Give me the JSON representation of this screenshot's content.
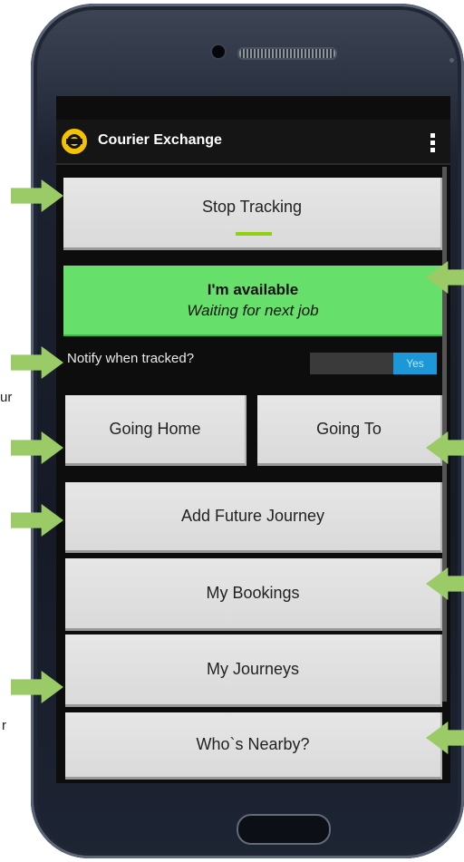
{
  "app": {
    "title": "Courier Exchange",
    "logo_icon": "courier-exchange-logo-icon",
    "menu_icon": "overflow-menu-icon"
  },
  "tracking": {
    "button_label": "Stop Tracking",
    "indicator_color": "#8fd10f"
  },
  "status": {
    "line1": "I'm available",
    "line2": "Waiting for next job",
    "color": "#66e06b"
  },
  "notify": {
    "label": "Notify when tracked?",
    "toggle_value": "Yes",
    "toggle_color": "#1c98d9"
  },
  "buttons": {
    "going_home": "Going Home",
    "going_to": "Going To",
    "add_future_journey": "Add Future Journey",
    "my_bookings": "My Bookings",
    "my_journeys": "My Journeys",
    "whos_nearby": "Who`s Nearby?"
  },
  "margin_text": {
    "left_1": "ur",
    "left_2": "r"
  },
  "annotation": {
    "arrow_color": "#9acb67"
  }
}
